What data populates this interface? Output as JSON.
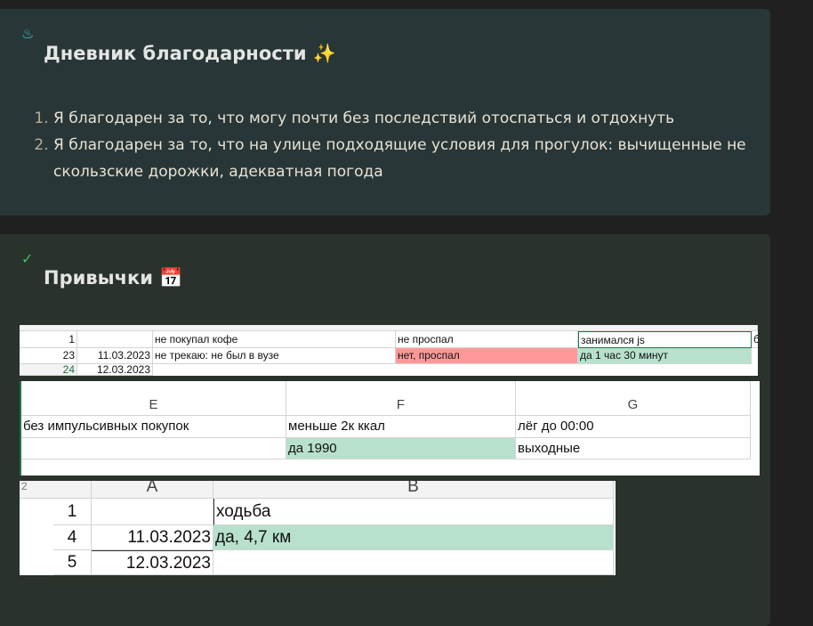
{
  "gratitude": {
    "icon": "flame-icon",
    "title": "Дневник благодарности ✨",
    "items": [
      "Я благодарен за то, что могу почти без последствий отоспаться и отдохнуть",
      "Я благодарен за то, что на улице подходящие условия для прогулок: вычищенные не скользские дорожки, адекватная погода"
    ]
  },
  "habits": {
    "icon": "check-icon",
    "title": "Привычки 📅",
    "sheet1": {
      "rows": [
        [
          "1",
          "",
          "не покупал кофе",
          "не проспал",
          "занимался js",
          "б"
        ],
        [
          "23",
          "11.03.2023",
          "не трекаю: не был в вузе",
          "нет, проспал",
          "да 1 час 30 минут",
          ""
        ],
        [
          "24",
          "12.03.2023",
          "",
          "",
          "",
          ""
        ]
      ]
    },
    "sheet2": {
      "headers": [
        "E",
        "F",
        "G"
      ],
      "rows": [
        [
          "без импульсивных покупок",
          "меньше 2к ккал",
          "лёг до 00:00"
        ],
        [
          "",
          "да 1990",
          "выходные"
        ]
      ]
    },
    "sheet3": {
      "level": "2",
      "headers": [
        "A",
        "B"
      ],
      "rows": [
        [
          "1",
          "",
          "ходьба"
        ],
        [
          "4",
          "11.03.2023",
          "да, 4,7 км"
        ],
        [
          "5",
          "12.03.2023",
          ""
        ]
      ]
    }
  },
  "colors": {
    "green": "#b7e1cd",
    "red": "#ff9999"
  }
}
